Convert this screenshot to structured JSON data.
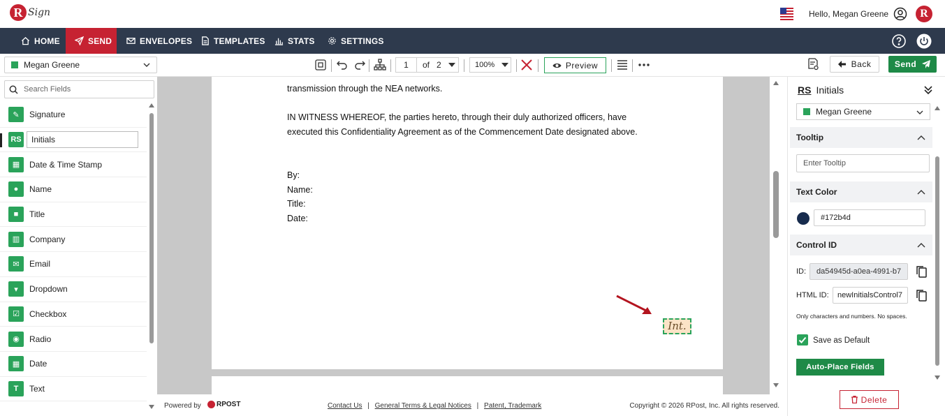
{
  "app": {
    "logo_letter": "R",
    "logo_text": "Sign"
  },
  "header": {
    "greeting": "Hello, Megan Greene",
    "avatar_letter": "R"
  },
  "nav": {
    "items": [
      {
        "label": "HOME",
        "icon": "home-icon"
      },
      {
        "label": "SEND",
        "icon": "send-icon",
        "active": true
      },
      {
        "label": "ENVELOPES",
        "icon": "envelope-icon"
      },
      {
        "label": "TEMPLATES",
        "icon": "document-icon"
      },
      {
        "label": "STATS",
        "icon": "bar-chart-icon"
      },
      {
        "label": "SETTINGS",
        "icon": "gear-icon"
      }
    ]
  },
  "toolbar": {
    "recipient": "Megan Greene",
    "page_current": "1",
    "page_of": "of",
    "page_total": "2",
    "zoom": "100%",
    "preview_label": "Preview",
    "back_label": "Back",
    "send_label": "Send"
  },
  "fields": {
    "search_placeholder": "Search Fields",
    "items": [
      {
        "label": "Signature",
        "icon": "pen-icon"
      },
      {
        "label": "Initials",
        "icon": "initials-icon",
        "selected": true
      },
      {
        "label": "Date & Time Stamp",
        "icon": "calendar-clock-icon"
      },
      {
        "label": "Name",
        "icon": "person-icon"
      },
      {
        "label": "Title",
        "icon": "briefcase-icon"
      },
      {
        "label": "Company",
        "icon": "building-icon"
      },
      {
        "label": "Email",
        "icon": "mail-icon"
      },
      {
        "label": "Dropdown",
        "icon": "dropdown-icon"
      },
      {
        "label": "Checkbox",
        "icon": "checkbox-icon"
      },
      {
        "label": "Radio",
        "icon": "radio-icon"
      },
      {
        "label": "Date",
        "icon": "calendar-icon"
      },
      {
        "label": "Text",
        "icon": "text-icon"
      }
    ]
  },
  "document": {
    "line1": "transmission through the NEA networks.",
    "line2": "IN WITNESS WHEREOF, the parties hereto, through their duly authorized officers, have",
    "line3": "executed this Confidentiality Agreement as of the Commencement Date designated above.",
    "by": "By:",
    "name": "Name:",
    "title": "Title:",
    "date": "Date:",
    "initials_field": "Int."
  },
  "footer": {
    "powered": "Powered by",
    "brand": "RPOST",
    "contact": "Contact Us",
    "terms": "General Terms & Legal Notices",
    "patent": "Patent, Trademark",
    "sep": "|",
    "copyright": "Copyright © 2026 RPost, Inc. All rights reserved."
  },
  "properties": {
    "title": "Initials",
    "title_icon": "RS",
    "recipient": "Megan Greene",
    "tooltip_head": "Tooltip",
    "tooltip_placeholder": "Enter Tooltip",
    "text_color_head": "Text Color",
    "text_color_value": "#172b4d",
    "control_id_head": "Control ID",
    "id_label": "ID:",
    "id_value": "da54945d-a0ea-4991-b7",
    "html_id_label": "HTML ID:",
    "html_id_value": "newInitialsControl7",
    "hint": "Only characters and numbers. No spaces.",
    "save_default": "Save as Default",
    "auto_place": "Auto-Place Fields",
    "delete": "Delete"
  },
  "colors": {
    "accent_green": "#2aa35a",
    "brand_red": "#c62232",
    "nav_bg": "#2e3a4d",
    "text_color": "#172b4d"
  }
}
